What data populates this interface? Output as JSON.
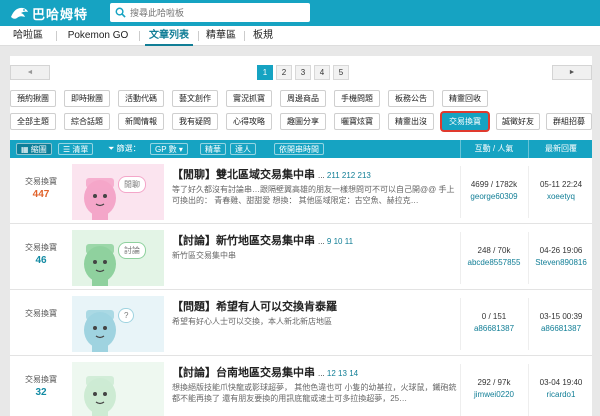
{
  "header": {
    "logo_text": "巴哈姆特",
    "search_placeholder": "搜尋此哈啦板"
  },
  "nav": {
    "tabs": [
      "哈啦區",
      "Pokemon GO",
      "文章列表",
      "精華區",
      "板規"
    ]
  },
  "pager": {
    "prev": "◄",
    "next": "►",
    "pages": [
      "1",
      "2",
      "3",
      "4",
      "5"
    ],
    "current_page": 1
  },
  "categories": {
    "row1": [
      "預約揪團",
      "即時揪團",
      "活動代碼",
      "藝文創作",
      "實況抓寶",
      "周邊商品",
      "手機問題",
      "板務公告",
      "精靈回收"
    ],
    "row2": [
      "全部主題",
      "綜合話題",
      "新聞情報",
      "我有疑問",
      "心得攻略",
      "趣圖分享",
      "曬寶炫寶",
      "精靈出沒",
      "交易換寶",
      "誠徵好友",
      "群組招募"
    ],
    "selected": "交易換寶"
  },
  "toolbar": {
    "thumb_view": "縮圖",
    "list_view": "清單",
    "filter_label": "篩選：",
    "gp_select": "GP 數",
    "featured": "精華",
    "experts": "達人",
    "sort_by_time": "依開串時間",
    "col_interaction": "互動 / 人氣",
    "col_latest": "最新回覆"
  },
  "colors": {
    "accent": "#16a3c2",
    "accent_dark": "#117e96",
    "gp_hot": "#e0622a",
    "gp_cool": "#128aa3",
    "highlight": "#e03a2e"
  },
  "threads": [
    {
      "category": "交易換寶",
      "gp": "447",
      "gp_color": "#e0622a",
      "thumb_tag": "閒聊",
      "thumb_color": "#f4a6c9",
      "thumb_bg": "#fbe4ef",
      "title": "【閒聊】雙北區域交易集中串",
      "page_ellipsis": "...",
      "pages": [
        "211",
        "212",
        "213"
      ],
      "desc": "等了好久都沒有討論串…跟隔壁翼高雄的朋友一樣想問可不可以自己開@@ 手上可換出的： 青春雞、甜甜愛 想換： 其他區域限定：古空魚、赫拉克…",
      "stats": "4699 / 1782k",
      "author": "george60309",
      "time": "05-11 22:24",
      "last_user": "xoeetyq"
    },
    {
      "category": "交易換寶",
      "gp": "46",
      "gp_color": "#128aa3",
      "thumb_tag": "討論",
      "thumb_color": "#8fd19e",
      "thumb_bg": "#e3f4e6",
      "title": "【討論】新竹地區交易集中串",
      "page_ellipsis": "...",
      "pages": [
        "9",
        "10",
        "11"
      ],
      "desc": "新竹區交易集中串",
      "stats": "248 / 70k",
      "author": "abcde8557855",
      "time": "04-26 19:06",
      "last_user": "Steven890816"
    },
    {
      "category": "交易換寶",
      "gp": "",
      "gp_color": "#128aa3",
      "thumb_tag": "?",
      "thumb_color": "#9fd3e0",
      "thumb_bg": "#e8f4f8",
      "title": "【問題】希望有人可以交換肯泰羅",
      "page_ellipsis": "",
      "pages": [],
      "desc": "希望有好心人士可以交換，本人新北新店地區",
      "stats": "0 / 151",
      "author": "a86681387",
      "time": "03-15 00:39",
      "last_user": "a86681387"
    },
    {
      "category": "交易換寶",
      "gp": "32",
      "gp_color": "#128aa3",
      "thumb_tag": "",
      "thumb_color": "#cdebd3",
      "thumb_bg": "#eef8f0",
      "title": "【討論】台南地區交易集中串",
      "page_ellipsis": "...",
      "pages": [
        "12",
        "13",
        "14"
      ],
      "desc": "想換絕版技能爪快龍或影球超夢， 其他色違也可 小隻的幼基拉，火球鼠，鐵砲銃都不能再換了 還有朋友要換的用訊底龍或速土可多拉換超夢，25…",
      "stats": "292 / 97k",
      "author": "jimwei0220",
      "time": "03-04 19:40",
      "last_user": "ricardo1"
    }
  ]
}
